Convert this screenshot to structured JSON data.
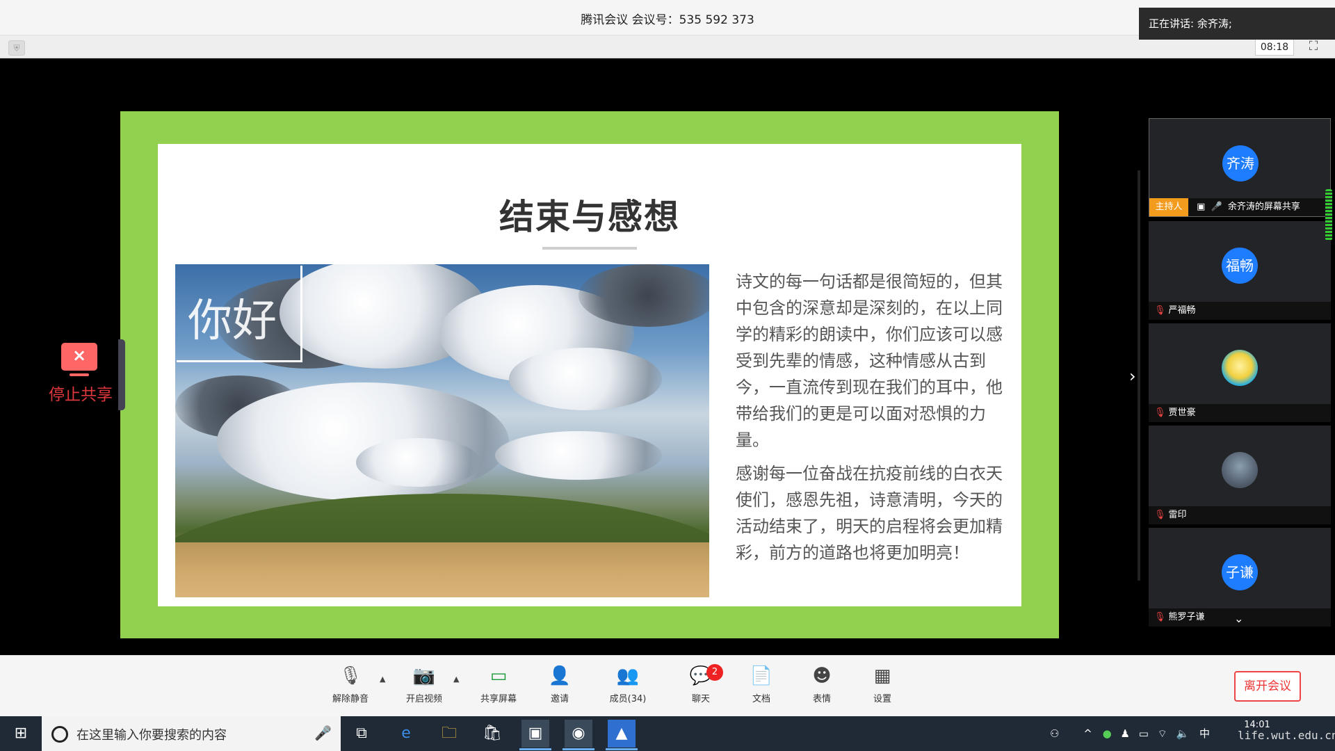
{
  "meeting": {
    "title": "腾讯会议 会议号：535 592 373",
    "timer": "08:18",
    "speaking": "正在讲话: 余齐涛;"
  },
  "slide": {
    "title": "结束与感想",
    "image_text": "你好",
    "para1": "诗文的每一句话都是很简短的，但其中包含的深意却是深刻的，在以上同学的精彩的朗读中，你们应该可以感受到先辈的情感，这种情感从古到今，一直流传到现在我们的耳中，他带给我们的更是可以面对恐惧的力量。",
    "para2": "感谢每一位奋战在抗疫前线的白衣天使们，感恩先祖，诗意清明，今天的活动结束了，明天的启程将会更加精彩，前方的道路也将更加明亮！"
  },
  "stop_share": {
    "label": "停止共享"
  },
  "participants": [
    {
      "avatar_text": "齐涛",
      "badge": "主持人",
      "name": "余齐涛的屏幕共享"
    },
    {
      "avatar_text": "福畅",
      "name": "严福畅"
    },
    {
      "avatar_text": "",
      "name": "贾世豪"
    },
    {
      "avatar_text": "",
      "name": "雷印"
    },
    {
      "avatar_text": "子谦",
      "name": "熊罗子谦"
    }
  ],
  "toolbar": {
    "unmute": "解除静音",
    "video": "开启视频",
    "share": "共享屏幕",
    "invite": "邀请",
    "members": "成员(34)",
    "chat": "聊天",
    "chat_badge": "2",
    "docs": "文档",
    "emoji": "表情",
    "settings": "设置",
    "leave": "离开会议"
  },
  "taskbar": {
    "search_placeholder": "在这里输入你要搜索的内容",
    "ime": "中",
    "time": "14:01",
    "watermark": "life.wut.edu.cn"
  },
  "colors": {
    "slide_border": "#92d050",
    "avatar_blue": "#1e7cff",
    "host_badge": "#f29b1d",
    "leave_red": "#e44444",
    "chat_badge": "#e22222"
  }
}
